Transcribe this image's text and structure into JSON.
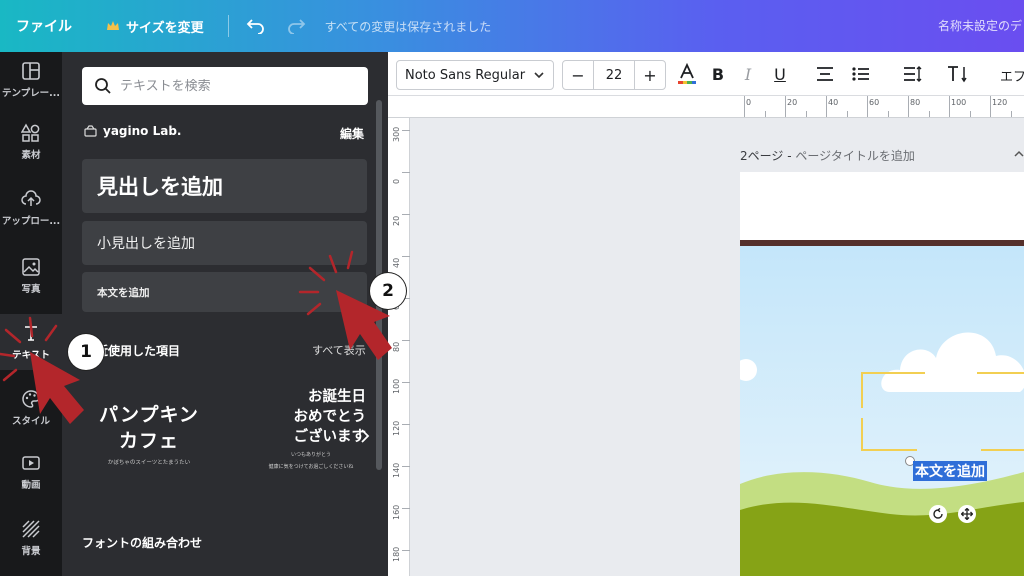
{
  "topbar": {
    "file": "ファイル",
    "resize": "サイズを変更",
    "saved": "すべての変更は保存されました",
    "doc_title": "名称未設定のデ"
  },
  "rail": {
    "templates": "テンプレー...",
    "elements": "素材",
    "uploads": "アップロー...",
    "photos": "写真",
    "text": "テキスト",
    "styles": "スタイル",
    "videos": "動画",
    "background": "背景"
  },
  "panel": {
    "search_placeholder": "テキストを検索",
    "brand_name": "yagino Lab.",
    "edit": "編集",
    "add_heading": "見出しを追加",
    "add_subheading": "小見出しを追加",
    "add_body": "本文を追加",
    "recent": "最近使用した項目",
    "see_all": "すべて表示",
    "font_combos": "フォントの組み合わせ",
    "thumb1_l1": "パンプキン",
    "thumb1_l2": "カフェ",
    "thumb1_small": "かぼちゃのスイーツとたまうたい",
    "thumb2_l1": "お誕生日",
    "thumb2_l2": "おめでとう",
    "thumb2_l3": "ございます",
    "thumb2_small1": "いつもありがとう",
    "thumb2_small2": "健康に気をつけてお過ごしくださいね"
  },
  "toolbar": {
    "font": "Noto Sans Regular",
    "font_size": "22",
    "minus": "−",
    "plus": "+",
    "bold": "B",
    "italic": "I",
    "underline": "U",
    "effects": "エフ",
    "text_color": "#2a2a2a"
  },
  "rulers": {
    "top": [
      "0",
      "20",
      "40",
      "60",
      "80",
      "100",
      "120"
    ],
    "left": [
      "300",
      "0",
      "20",
      "40",
      "60",
      "80",
      "100",
      "120",
      "140",
      "160",
      "180"
    ]
  },
  "canvas": {
    "page_label": "2ページ - ",
    "page_hint": "ページタイトルを追加",
    "selected_text": "本文を追加"
  },
  "annotations": {
    "step1": "1",
    "step2": "2"
  },
  "colors": {
    "arrow": "#b3262b",
    "selection_frame": "#f2cf52",
    "text_highlight": "#2f6ed8",
    "hill_light": "#c3de82",
    "hill_dark": "#86a316"
  }
}
